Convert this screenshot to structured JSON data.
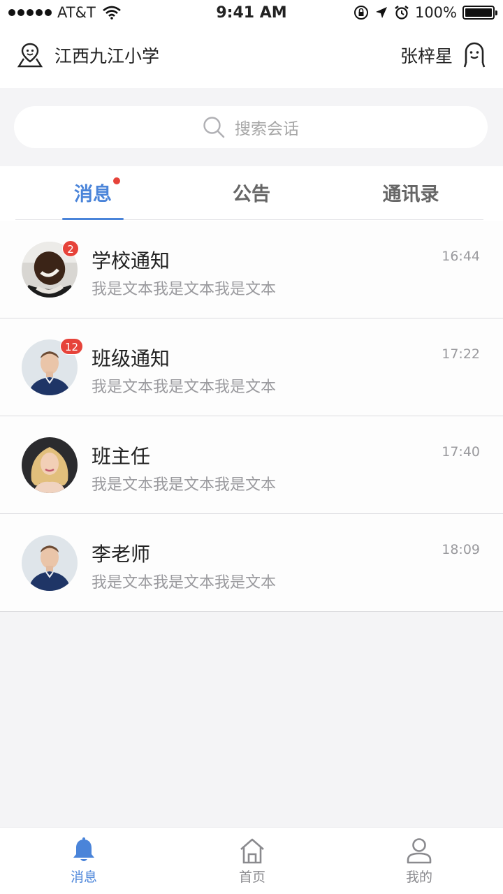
{
  "status_bar": {
    "carrier": "AT&T",
    "time": "9:41 AM",
    "battery": "100%"
  },
  "header": {
    "school_name": "江西九江小学",
    "user_name": "张梓星"
  },
  "search": {
    "placeholder": "搜索会话"
  },
  "tabs": [
    {
      "label": "消息",
      "active": true,
      "has_dot": true
    },
    {
      "label": "公告",
      "active": false
    },
    {
      "label": "通讯录",
      "active": false
    }
  ],
  "conversations": [
    {
      "title": "学校通知",
      "preview": "我是文本我是文本我是文本",
      "time": "16:44",
      "badge": "2",
      "avatar": "dark-skinned-man-avatar"
    },
    {
      "title": "班级通知",
      "preview": "我是文本我是文本我是文本",
      "time": "17:22",
      "badge": "12",
      "avatar": "young-man-blue-shirt-avatar"
    },
    {
      "title": "班主任",
      "preview": "我是文本我是文本我是文本",
      "time": "17:40",
      "badge": "",
      "avatar": "blonde-woman-avatar"
    },
    {
      "title": "李老师",
      "preview": "我是文本我是文本我是文本",
      "time": "18:09",
      "badge": "",
      "avatar": "young-man-blue-shirt-avatar"
    }
  ],
  "bottom_nav": [
    {
      "label": "消息",
      "icon": "bell-icon",
      "active": true
    },
    {
      "label": "首页",
      "icon": "home-icon",
      "active": false
    },
    {
      "label": "我的",
      "icon": "person-icon",
      "active": false
    }
  ],
  "colors": {
    "accent": "#4a84d9",
    "badge": "#e6433a",
    "background": "#f4f4f6"
  }
}
